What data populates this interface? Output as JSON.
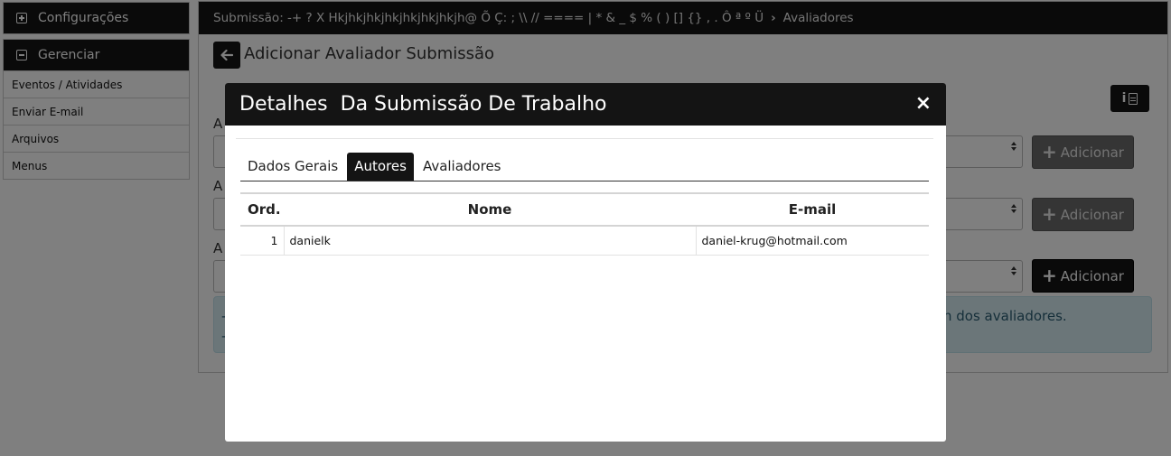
{
  "sidebar": {
    "config_label": "Configurações",
    "manage_label": "Gerenciar",
    "items": [
      {
        "label": "Eventos / Atividades"
      },
      {
        "label": "Enviar E-mail"
      },
      {
        "label": "Arquivos"
      },
      {
        "label": "Menus"
      }
    ]
  },
  "main": {
    "breadcrumb": {
      "submission": "Submissão: -+ ? X Hkjhkjhkjhkjhkjhkjhkjh@ Õ Ç: ; \\\\ // ==== | * & _ $ % ( ) [] {} , . Ô ª º Ü",
      "current": "Avaliadores"
    },
    "page_title": "Adicionar Avaliador Submissão",
    "fields": [
      {
        "label": "A",
        "button": "Adicionar"
      },
      {
        "label": "A",
        "button": "Adicionar"
      },
      {
        "label": "A",
        "button": "Adicionar"
      }
    ],
    "alert": {
      "prefix": "-",
      "prefix2": "-",
      "tail": "n dos avaliadores."
    }
  },
  "modal": {
    "title": "Detalhes  Da Submissão De Trabalho",
    "close": "×",
    "tabs": [
      {
        "label": "Dados Gerais",
        "active": false
      },
      {
        "label": "Autores",
        "active": true
      },
      {
        "label": "Avaliadores",
        "active": false
      }
    ],
    "table": {
      "headers": [
        "Ord.",
        "Nome",
        "E-mail"
      ],
      "rows": [
        {
          "ord": "1",
          "nome": "danielk",
          "email": "daniel-krug@hotmail.com"
        }
      ]
    }
  }
}
